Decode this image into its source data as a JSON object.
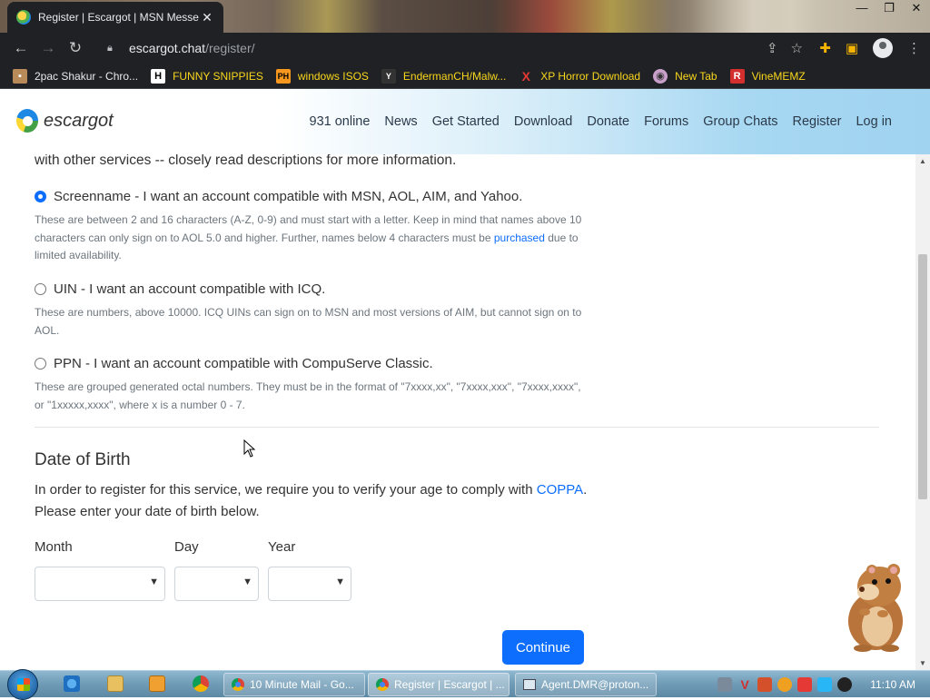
{
  "browser": {
    "tab_title": "Register | Escargot | MSN Messe",
    "url_host": "escargot.chat",
    "url_path": "/register/",
    "bookmarks": [
      {
        "label": "2pac Shakur - Chro...",
        "icon": "photo-icon"
      },
      {
        "label": "FUNNY SNIPPIES",
        "icon": "H"
      },
      {
        "label": "windows ISOS",
        "icon": "PH"
      },
      {
        "label": "EndermanCH/Malw...",
        "icon": "Y"
      },
      {
        "label": "XP Horror Download",
        "icon": "X"
      },
      {
        "label": "New Tab",
        "icon": "globe-icon"
      },
      {
        "label": "VineMEMZ",
        "icon": "R"
      }
    ]
  },
  "site": {
    "logo_text": "escargot",
    "nav": [
      "931 online",
      "News",
      "Get Started",
      "Download",
      "Donate",
      "Forums",
      "Group Chats",
      "Register",
      "Log in"
    ]
  },
  "form": {
    "lead_text": "with other services -- closely read descriptions for more information.",
    "options": [
      {
        "label": "Screenname - I want an account compatible with MSN, AOL, AIM, and Yahoo.",
        "selected": true,
        "desc_before_link": "These are between 2 and 16 characters (A-Z, 0-9) and must start with a letter. Keep in mind that names above 10 characters can only sign on to AOL 5.0 and higher. Further, names below 4 characters must be ",
        "desc_link": "purchased",
        "desc_after_link": " due to limited availability."
      },
      {
        "label": "UIN - I want an account compatible with ICQ.",
        "selected": false,
        "desc": "These are numbers, above 10000. ICQ UINs can sign on to MSN and most versions of AIM, but cannot sign on to AOL."
      },
      {
        "label": "PPN - I want an account compatible with CompuServe Classic.",
        "selected": false,
        "desc": "These are grouped generated octal numbers. They must be in the format of \"7xxxx,xx\", \"7xxxx,xxx\", \"7xxxx,xxxx\", or \"1xxxxx,xxxx\", where x is a number 0 - 7."
      }
    ],
    "dob_heading": "Date of Birth",
    "dob_text_before": "In order to register for this service, we require you to verify your age to comply with ",
    "dob_link": "COPPA",
    "dob_text_after": ". Please enter your date of birth below.",
    "month_label": "Month",
    "day_label": "Day",
    "year_label": "Year",
    "month_value": "",
    "day_value": "",
    "year_value": "",
    "continue_label": "Continue"
  },
  "taskbar": {
    "windows": [
      {
        "label": "10 Minute Mail - Go...",
        "active": false
      },
      {
        "label": "Register | Escargot | ...",
        "active": true
      },
      {
        "label": "Agent.DMR@proton...",
        "active": false
      }
    ],
    "clock": "11:10 AM"
  },
  "colors": {
    "primary": "#0d6efd",
    "chrome_dark": "#202124",
    "text": "#333333",
    "muted": "#6c757d"
  }
}
